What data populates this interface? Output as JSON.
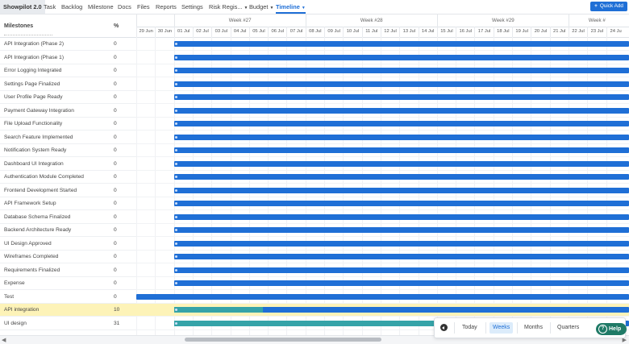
{
  "nav": {
    "brand": "Showpilot 2.0",
    "items": [
      {
        "label": "Task"
      },
      {
        "label": "Backlog"
      },
      {
        "label": "Milestone"
      },
      {
        "label": "Docs"
      },
      {
        "label": "Files"
      },
      {
        "label": "Reports"
      },
      {
        "label": "Settings"
      },
      {
        "label": "Risk Regis..."
      },
      {
        "label": "Budget"
      },
      {
        "label": "Timeline"
      }
    ],
    "quick_add": "Quick Add"
  },
  "table": {
    "col_milestones": "Milestones",
    "col_pct": "%",
    "rows": [
      {
        "name": "API Integration (Phase 2)",
        "pct": "0",
        "progress": 0
      },
      {
        "name": "API Integration (Phase 1)",
        "pct": "0",
        "progress": 0
      },
      {
        "name": "Error Logging Integrated",
        "pct": "0",
        "progress": 0
      },
      {
        "name": "Settings Page Finalized",
        "pct": "0",
        "progress": 0
      },
      {
        "name": "User Profile Page Ready",
        "pct": "0",
        "progress": 0
      },
      {
        "name": "Payment Gateway Integration",
        "pct": "0",
        "progress": 0
      },
      {
        "name": "File Upload Functionality",
        "pct": "0",
        "progress": 0
      },
      {
        "name": "Search Feature Implemented",
        "pct": "0",
        "progress": 0
      },
      {
        "name": "Notification System Ready",
        "pct": "0",
        "progress": 0
      },
      {
        "name": "Dashboard UI Integration",
        "pct": "0",
        "progress": 0
      },
      {
        "name": "Authentication Module Completed",
        "pct": "0",
        "progress": 0
      },
      {
        "name": "Frontend Development Started",
        "pct": "0",
        "progress": 0
      },
      {
        "name": "API Framework Setup",
        "pct": "0",
        "progress": 0
      },
      {
        "name": "Database Schema Finalized",
        "pct": "0",
        "progress": 0
      },
      {
        "name": "Backend Architecture Ready",
        "pct": "0",
        "progress": 0
      },
      {
        "name": "UI Design Approved",
        "pct": "0",
        "progress": 0
      },
      {
        "name": "Wireframes Completed",
        "pct": "0",
        "progress": 0
      },
      {
        "name": "Requirements Finalized",
        "pct": "0",
        "progress": 0
      },
      {
        "name": "Expense",
        "pct": "0",
        "progress": 0
      },
      {
        "name": "Test",
        "pct": "0",
        "progress": 0
      },
      {
        "name": "API integration",
        "pct": "10",
        "progress": 0.1
      },
      {
        "name": "UI design",
        "pct": "31",
        "progress": 0.31
      }
    ]
  },
  "timeline": {
    "weeks": [
      {
        "label": ""
      },
      {
        "label": "Week #27"
      },
      {
        "label": "Week #28"
      },
      {
        "label": "Week #29"
      },
      {
        "label": "Week #"
      }
    ],
    "days": [
      "29 Jun",
      "30 Jun",
      "01 Jul",
      "02 Jul",
      "03 Jul",
      "04 Jul",
      "05 Jul",
      "06 Jul",
      "07 Jul",
      "08 Jul",
      "09 Jul",
      "10 Jul",
      "11 Jul",
      "12 Jul",
      "13 Jul",
      "14 Jul",
      "15 Jul",
      "16 Jul",
      "17 Jul",
      "18 Jul",
      "19 Jul",
      "20 Jul",
      "21 Jul",
      "22 Jul",
      "23 Jul",
      "24 Ju"
    ]
  },
  "zoom": {
    "today": "Today",
    "weeks": "Weeks",
    "months": "Months",
    "quarters": "Quarters"
  },
  "help": "Help",
  "colors": {
    "accent": "#1f6fd6",
    "progress": "#35a3a8",
    "highlight": "#fdf3b8"
  }
}
